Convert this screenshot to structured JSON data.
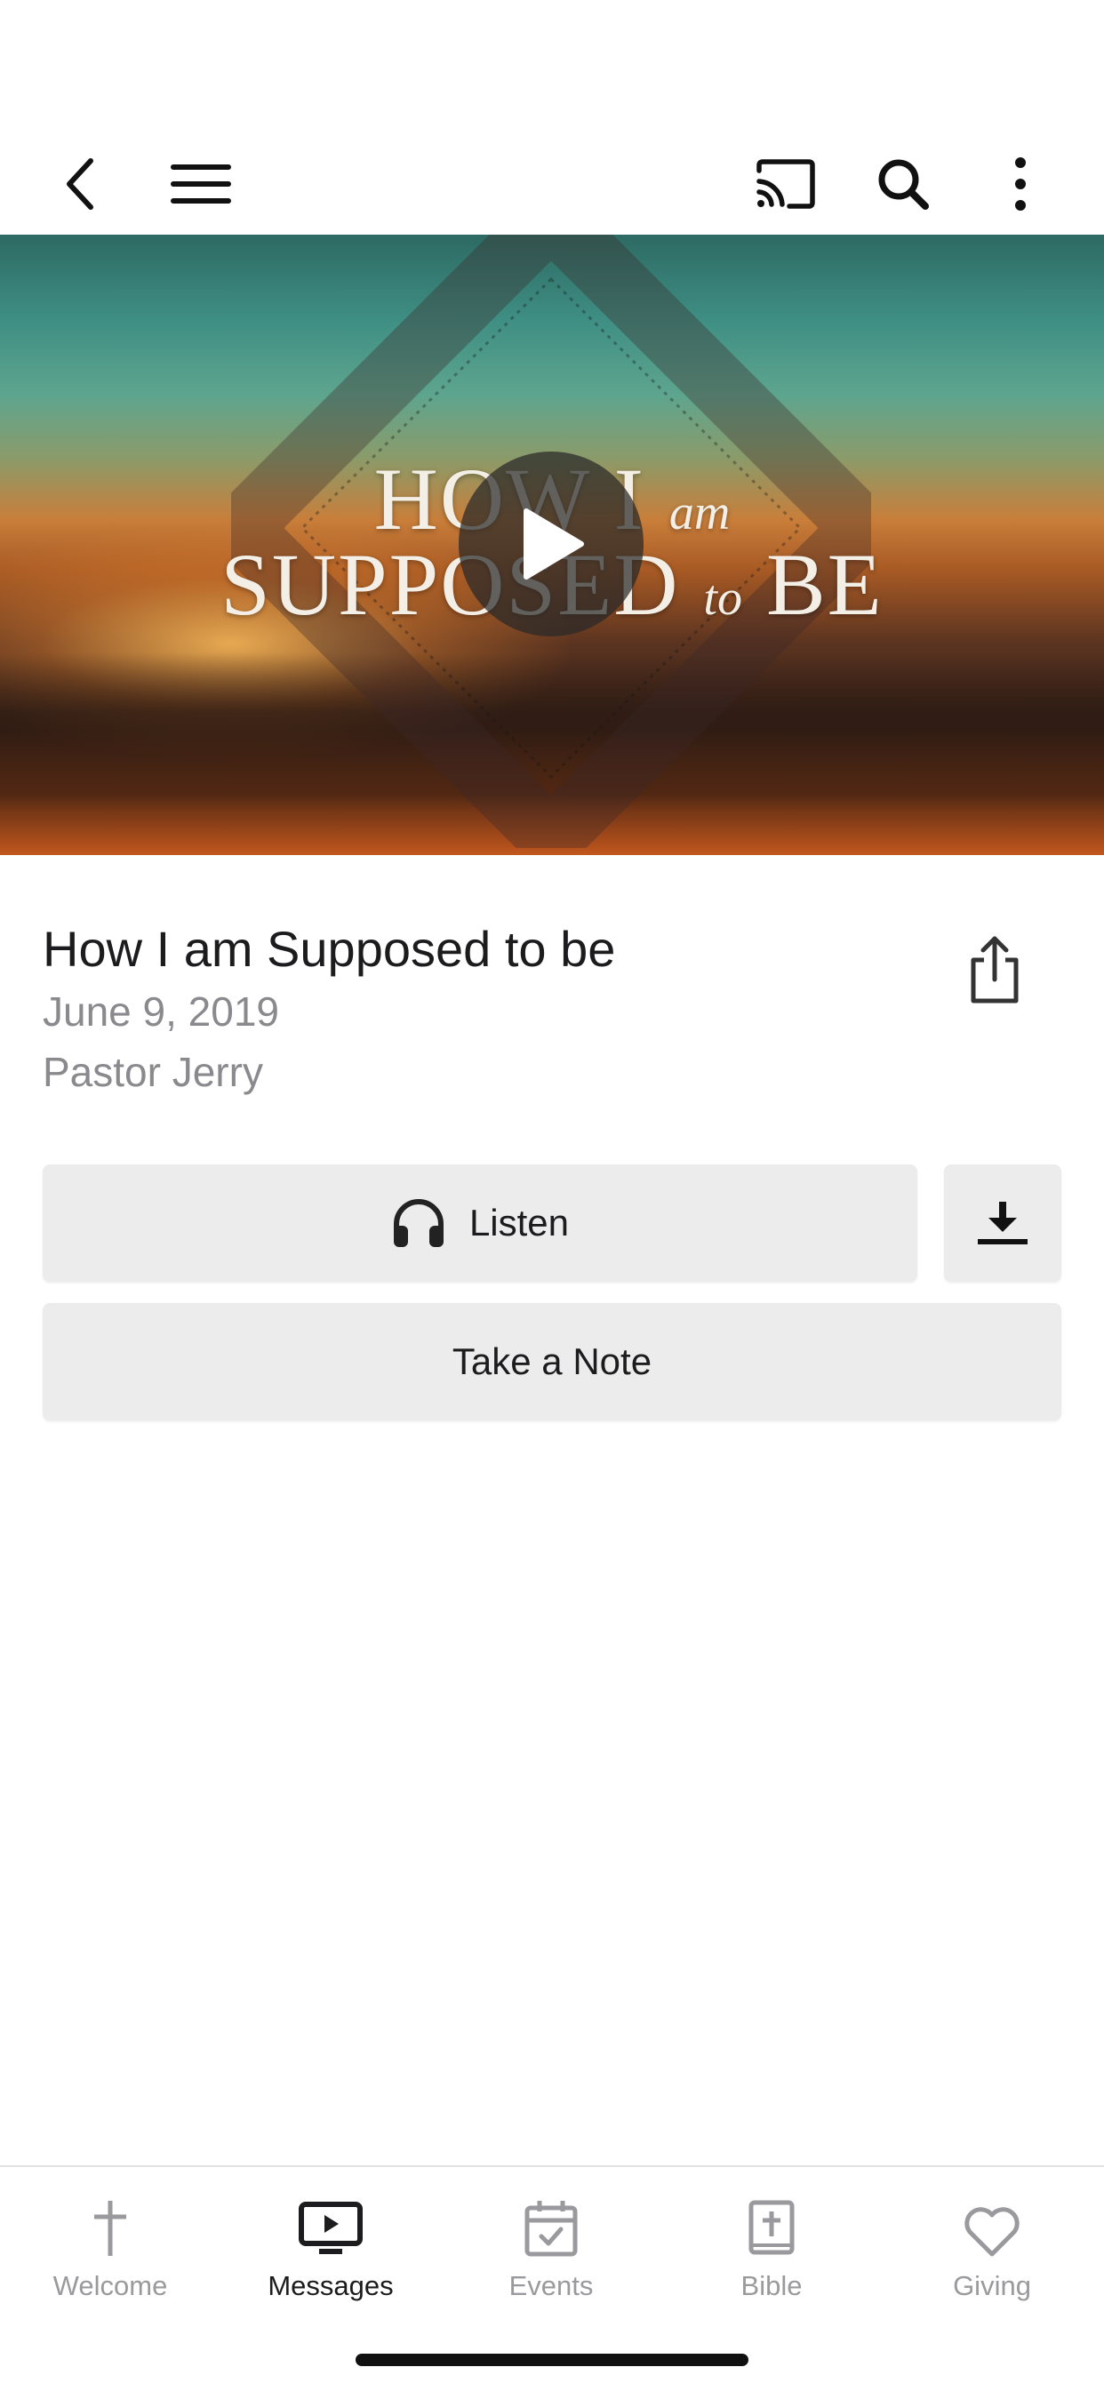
{
  "toolbar": {
    "back_icon": "chevron-left-icon",
    "menu_icon": "hamburger-menu-icon",
    "cast_icon": "cast-icon",
    "search_icon": "search-icon",
    "more_icon": "more-vertical-icon"
  },
  "hero": {
    "title_line1": "HOW I",
    "title_line1_italic": "am",
    "title_line2_a": "SUPPOSED",
    "title_line2_italic": "to",
    "title_line2_b": "BE",
    "play_icon": "play-icon"
  },
  "message": {
    "title": "How I am Supposed to be",
    "date": "June 9, 2019",
    "speaker": "Pastor Jerry",
    "share_icon": "share-icon"
  },
  "actions": {
    "listen_label": "Listen",
    "listen_icon": "headphones-icon",
    "download_icon": "download-icon",
    "note_label": "Take a Note"
  },
  "tabs": [
    {
      "label": "Welcome",
      "icon": "cross-icon",
      "active": false
    },
    {
      "label": "Messages",
      "icon": "tv-play-icon",
      "active": true
    },
    {
      "label": "Events",
      "icon": "calendar-check-icon",
      "active": false
    },
    {
      "label": "Bible",
      "icon": "bible-icon",
      "active": false
    },
    {
      "label": "Giving",
      "icon": "heart-icon",
      "active": false
    }
  ],
  "colors": {
    "accent_text": "#1c1c1e",
    "secondary_text": "#8a8a8e",
    "button_bg": "#ececed",
    "inactive_tab": "#9a9a9e"
  }
}
